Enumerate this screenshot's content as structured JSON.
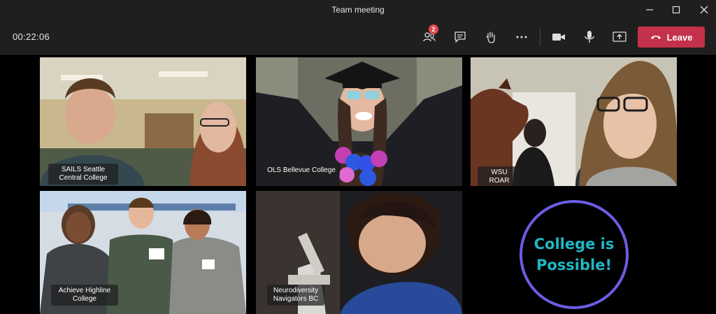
{
  "window": {
    "title": "Team meeting"
  },
  "toolbar": {
    "timer": "00:22:06",
    "participants_badge": "2",
    "leave_label": "Leave"
  },
  "tiles": [
    {
      "label": "SAILS Seattle Central College"
    },
    {
      "label": "OLS Bellevue College"
    },
    {
      "label": "WSU ROAR"
    },
    {
      "label": "Achieve Highline College"
    },
    {
      "label": "Neurodiversity Navigators BC"
    }
  ],
  "graphic": {
    "line1": "College is",
    "line2": "Possible!"
  },
  "colors": {
    "leave": "#c4314b",
    "badge": "#e04a4a",
    "circle_border": "#6b5de3",
    "circle_text": "#1fb8c4"
  },
  "icons": [
    "minimize-icon",
    "maximize-icon",
    "close-icon",
    "participants-icon",
    "chat-icon",
    "raise-hand-icon",
    "more-icon",
    "camera-icon",
    "microphone-icon",
    "share-screen-icon",
    "phone-hangup-icon"
  ]
}
